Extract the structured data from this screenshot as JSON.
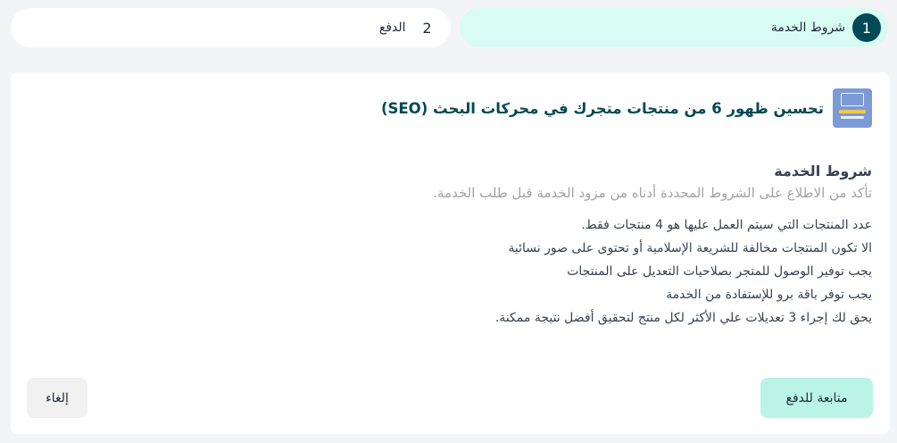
{
  "steps": [
    {
      "number": "1",
      "label": "شروط الخدمة"
    },
    {
      "number": "2",
      "label": "الدفع"
    }
  ],
  "product": {
    "title": "تحسين ظهور 6 من منتجات متجرك في محركات البحث (SEO)",
    "thumb_icon": "seo-service-thumbnail"
  },
  "terms": {
    "heading": "شروط الخدمة",
    "subtitle": "تأكد من الاطلاع على الشروط المحددة أدناه من مزود الخدمة قبل طلب الخدمة.",
    "items": [
      "عدد المنتجات التي سيتم العمل عليها هو 4 منتجات فقط.",
      "الا تكون المنتجات مخالفة للشريعة الإسلامية أو تحتوى على صور نسائية",
      "يجب توفير الوصول للمتجر بصلاحيات التعديل على المنتجات",
      "يجب توفر باقة برو للإستفادة من الخدمة",
      "يحق لك إجراء 3 تعديلات علي الأكثر لكل منتج لتحقيق أفضل نتيجة ممكنة."
    ]
  },
  "actions": {
    "continue_label": "متابعة للدفع",
    "cancel_label": "إلغاء"
  },
  "colors": {
    "accent_dark": "#004956",
    "active_step_bg": "#d8fbf2",
    "continue_bg": "#baf4e6"
  }
}
